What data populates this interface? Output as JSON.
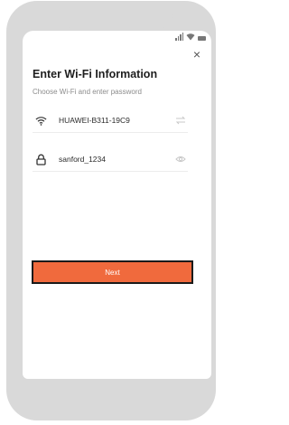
{
  "header": {
    "close_label": "×",
    "title": "Enter Wi-Fi Information",
    "subtitle": "Choose Wi-Fi and enter password"
  },
  "wifi": {
    "ssid": "HUAWEI-B311-19C9",
    "icon": "wifi-icon",
    "trailing_icon": "switch-network-icon"
  },
  "password": {
    "value": "sanford_1234",
    "icon": "lock-icon",
    "trailing_icon": "eye-icon"
  },
  "actions": {
    "next_label": "Next",
    "accent_color": "#f06a3d"
  }
}
